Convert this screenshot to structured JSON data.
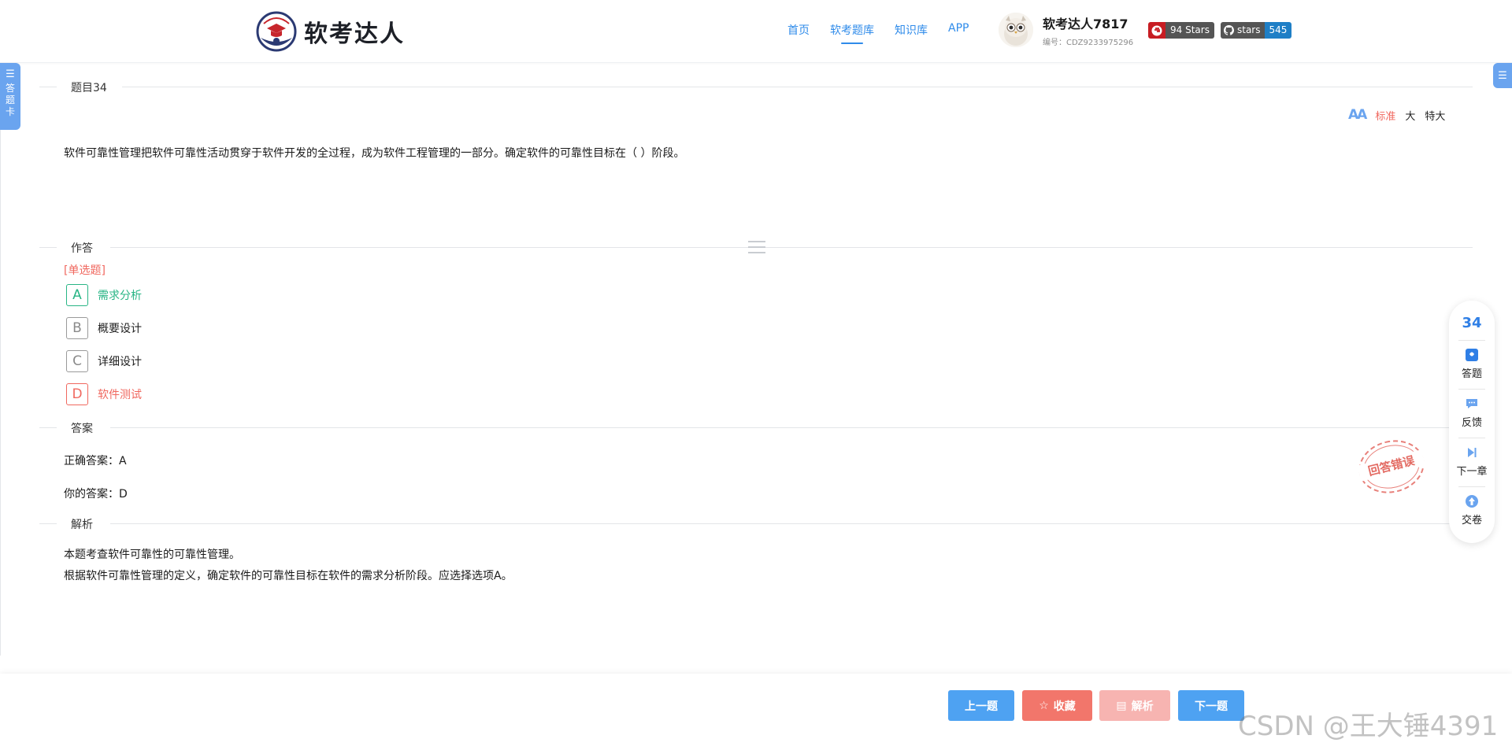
{
  "header": {
    "logo_text": "软考达人",
    "nav": [
      {
        "label": "首页",
        "active": false
      },
      {
        "label": "软考题库",
        "active": true
      },
      {
        "label": "知识库",
        "active": false
      },
      {
        "label": "APP",
        "active": false
      }
    ],
    "user": {
      "name": "软考达人7817",
      "id": "编号：CDZ9233975296"
    },
    "gitee_badge": {
      "label": "94 Stars"
    },
    "github_badge": {
      "left": "stars",
      "right": "545"
    }
  },
  "answer_card_tab": {
    "label": "答题卡"
  },
  "question": {
    "section_title": "题目34",
    "text": "软件可靠性管理把软件可靠性活动贯穿于软件开发的全过程，成为软件工程管理的一部分。确定软件的可靠性目标在（ ）阶段。"
  },
  "font_size": {
    "options": [
      "标准",
      "大",
      "特大"
    ],
    "selected": "标准"
  },
  "answer_section": {
    "title": "作答",
    "type_label": "[单选题]",
    "options": [
      {
        "key": "A",
        "text": "需求分析",
        "state": "correct"
      },
      {
        "key": "B",
        "text": "概要设计",
        "state": "normal"
      },
      {
        "key": "C",
        "text": "详细设计",
        "state": "normal"
      },
      {
        "key": "D",
        "text": "软件测试",
        "state": "wrong"
      }
    ]
  },
  "result_section": {
    "title": "答案",
    "correct_answer": "正确答案：A",
    "your_answer": "你的答案：D",
    "stamp_text": "回答错误"
  },
  "explanation_section": {
    "title": "解析",
    "lines": [
      "本题考查软件可靠性的可靠性管理。",
      "根据软件可靠性管理的定义，确定软件的可靠性目标在软件的需求分析阶段。应选择选项A。"
    ]
  },
  "side_panel": {
    "question_number": "34",
    "items": [
      "答题",
      "反馈",
      "下一章",
      "交卷"
    ]
  },
  "bottom_buttons": {
    "prev": "上一题",
    "favorite": "收藏",
    "explain": "解析",
    "next": "下一题"
  },
  "watermark": "CSDN @王大锤4391",
  "colors": {
    "primary": "#2f8bea",
    "correct": "#28b585",
    "wrong": "#f0685f",
    "button_blue": "#4ea2f2",
    "button_red": "#f2766b"
  }
}
